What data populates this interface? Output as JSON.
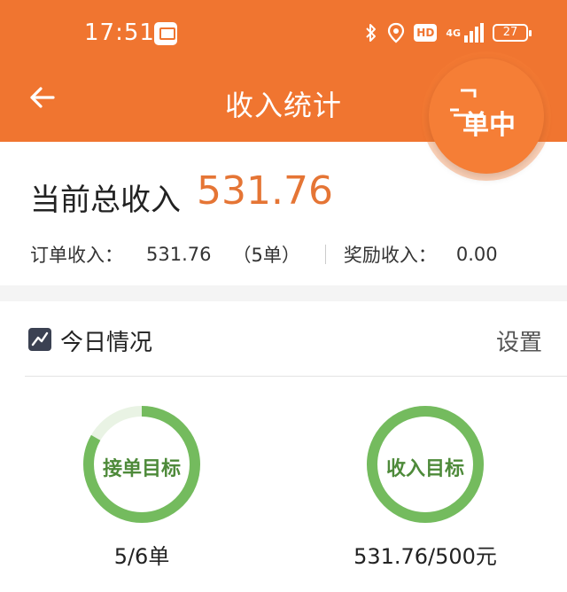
{
  "status_bar": {
    "time": "17:51",
    "hd_label": "HD",
    "network_label": "4G",
    "battery": "27",
    "icons": [
      "bluetooth-icon",
      "location-icon",
      "hd-icon",
      "signal-icon",
      "battery-icon"
    ]
  },
  "header": {
    "title": "收入统计",
    "back_icon": "arrow-left-icon",
    "float_badge_text": "单中",
    "float_badge_icon": "truck-icon",
    "bg_color": "#f07530"
  },
  "summary": {
    "total_label": "当前总收入",
    "total_value": "531.76",
    "order_income_label": "订单收入：",
    "order_income_value": "531.76",
    "order_count": "（5单）",
    "reward_income_label": "奖励收入：",
    "reward_income_value": "0.00",
    "accent_color": "#e57535"
  },
  "today": {
    "icon": "trend-chart-icon",
    "title": "今日情况",
    "settings_label": "设置",
    "goals": [
      {
        "label": "接单目标",
        "value_text": "5/6单",
        "progress": 0.8333,
        "ring_color": "#74bb5e"
      },
      {
        "label": "收入目标",
        "value_text": "531.76/500元",
        "progress": 1.0,
        "ring_color": "#74bb5e"
      }
    ]
  }
}
